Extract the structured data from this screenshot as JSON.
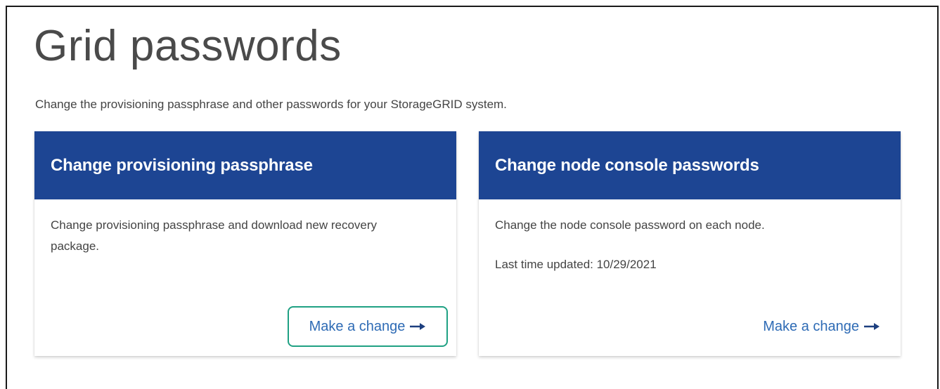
{
  "page": {
    "title": "Grid passwords",
    "subtitle": "Change the provisioning passphrase and other passwords for your StorageGRID system."
  },
  "cards": [
    {
      "header": "Change provisioning passphrase",
      "description": "Change provisioning passphrase and download new recovery package.",
      "action_label": "Make a change",
      "action_icon": "arrow-right-icon"
    },
    {
      "header": "Change node console passwords",
      "description": "Change the node console password on each node.",
      "meta": "Last time updated: 10/29/2021",
      "action_label": "Make a change",
      "action_icon": "arrow-right-icon"
    }
  ],
  "colors": {
    "header_bg": "#1d4593",
    "link": "#2e6bb5",
    "focus_outline": "#1fa183"
  }
}
